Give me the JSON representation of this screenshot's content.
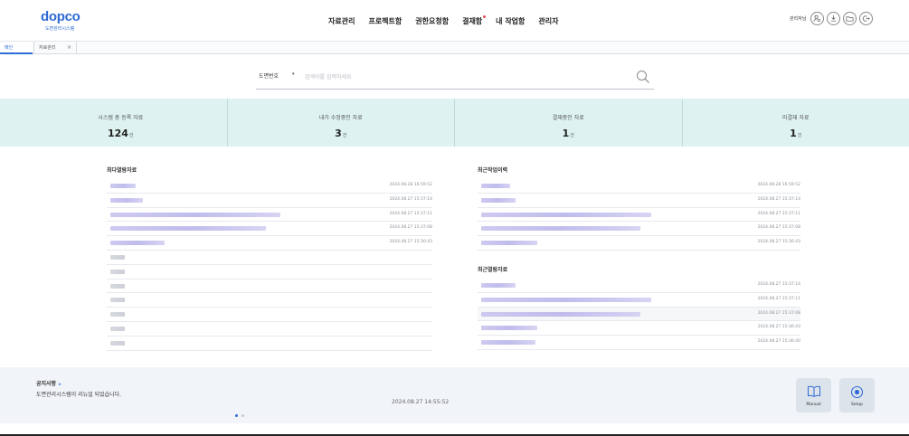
{
  "header": {
    "logo_main": "dopco",
    "logo_sub": "도면관리시스템",
    "nav": [
      {
        "label": "자료관리",
        "has_badge": false
      },
      {
        "label": "프로젝트함",
        "has_badge": false
      },
      {
        "label": "권한요청함",
        "has_badge": false
      },
      {
        "label": "결재함",
        "has_badge": true
      },
      {
        "label": "내 작업함",
        "has_badge": false
      },
      {
        "label": "관리자",
        "has_badge": false
      }
    ],
    "user_name": "관리자님",
    "icons": [
      "user-settings-icon",
      "download-icon",
      "folder-icon",
      "logout-icon"
    ]
  },
  "tabs": {
    "main": "메인",
    "second": "자료관리",
    "close": "×"
  },
  "search": {
    "type_label": "도면번호",
    "caret": "▾",
    "placeholder": "검색어를 입력하세요"
  },
  "stats": [
    {
      "label": "시스템 총 등록 자료",
      "value": "124",
      "unit": "건"
    },
    {
      "label": "내가 수정중인 자료",
      "value": "3",
      "unit": "건"
    },
    {
      "label": "결재중인 자료",
      "value": "1",
      "unit": "건"
    },
    {
      "label": "미결재 자료",
      "value": "1",
      "unit": "건"
    }
  ],
  "most_viewed": {
    "title": "최다열람자료",
    "rows": [
      {
        "date": "2024.08.28 16:59:52"
      },
      {
        "date": "2024.08.27 15:37:14"
      },
      {
        "date": "2024.08.27 15:37:11"
      },
      {
        "date": "2024.08.27 15:37:08"
      },
      {
        "date": "2024.08.27 15:30:43"
      },
      {
        "date": ""
      },
      {
        "date": ""
      },
      {
        "date": ""
      },
      {
        "date": ""
      },
      {
        "date": ""
      },
      {
        "date": ""
      },
      {
        "date": ""
      }
    ]
  },
  "recent_work": {
    "title": "최근작업이력",
    "rows": [
      {
        "date": "2024.08.28 16:59:52"
      },
      {
        "date": "2024.08.27 15:37:14"
      },
      {
        "date": "2024.08.27 15:37:11"
      },
      {
        "date": "2024.08.27 15:37:08"
      },
      {
        "date": "2024.08.27 15:36:43"
      }
    ]
  },
  "recent_viewed": {
    "title": "최근열람자료",
    "rows": [
      {
        "date": "2024.08.27 15:37:14"
      },
      {
        "date": "2024.08.27 15:37:11"
      },
      {
        "date": "2024.08.27 15:37:08"
      },
      {
        "date": "2024.08.27 15:36:43"
      },
      {
        "date": "2024.08.27 15:36:40"
      }
    ]
  },
  "notice": {
    "title": "공지사항",
    "arrow": "▸",
    "text": "도면관리시스템이 리뉴얼 되었습니다.",
    "date": "2024.08.27 14:55:52",
    "page_count": 2,
    "current_page": 1
  },
  "footer_buttons": {
    "manual": "Manual",
    "setup": "Setup"
  },
  "colors": {
    "accent": "#2f6bd6",
    "stats_bg": "#def3f1",
    "footer_bg": "#f1f4f8"
  }
}
